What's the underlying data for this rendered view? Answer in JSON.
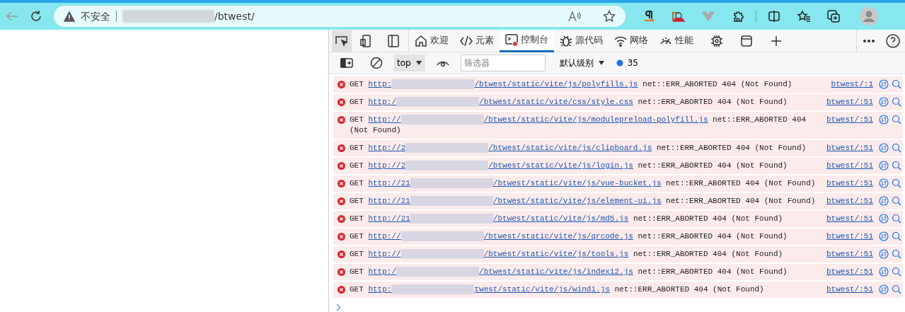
{
  "browser": {
    "address": {
      "security_label": "不安全",
      "url": "/btwest/"
    }
  },
  "devtools": {
    "tabs": [
      {
        "kind": "home",
        "label": "欢迎",
        "selected": false
      },
      {
        "kind": "code",
        "label": "元素",
        "selected": false
      },
      {
        "kind": "console",
        "label": "控制台",
        "selected": true
      },
      {
        "kind": "bug",
        "label": "源代码",
        "selected": false
      },
      {
        "kind": "wifi",
        "label": "网络",
        "selected": false
      },
      {
        "kind": "gauge",
        "label": "性能",
        "selected": false
      }
    ],
    "console_toolbar": {
      "context": "top",
      "filter_placeholder": "筛选器",
      "level_label": "默认级别",
      "issues_count": "35"
    },
    "messages": [
      {
        "method": "GET",
        "url_start": "http:",
        "url_end": "/btwest/static/vite/js/polyfills.js",
        "text": "net::ERR_ABORTED 404 (Not Found)",
        "source": "btwest/:1"
      },
      {
        "method": "GET",
        "url_start": "http:/",
        "url_end": "/btwest/static/vite/css/style.css",
        "text": "net::ERR_ABORTED 404 (Not Found)",
        "source": "btwest/:51"
      },
      {
        "method": "GET",
        "url_start": "http://",
        "url_end": "/btwest/static/vite/js/modulepreload-polyfill.js",
        "text": "net::ERR_ABORTED 404 (Not Found)",
        "source": "btwest/:51"
      },
      {
        "method": "GET",
        "url_start": "http://2",
        "url_end": "/btwest/static/vite/js/clipboard.js",
        "text": "net::ERR_ABORTED 404 (Not Found)",
        "source": "btwest/:51"
      },
      {
        "method": "GET",
        "url_start": "http://2",
        "url_end": "/btwest/static/vite/js/login.js",
        "text": "net::ERR_ABORTED 404 (Not Found)",
        "source": "btwest/:51"
      },
      {
        "method": "GET",
        "url_start": "http://21",
        "url_end": "/btwest/static/vite/js/vue-bucket.js",
        "text": "net::ERR_ABORTED 404 (Not Found)",
        "source": "btwest/:51"
      },
      {
        "method": "GET",
        "url_start": "http://21",
        "url_end": "/btwest/static/vite/js/element-ui.js",
        "text": "net::ERR_ABORTED 404 (Not Found)",
        "source": "btwest/:51"
      },
      {
        "method": "GET",
        "url_start": "http://21",
        "url_end": "/btwest/static/vite/js/md5.js",
        "text": "net::ERR_ABORTED 404 (Not Found)",
        "source": "btwest/:51"
      },
      {
        "method": "GET",
        "url_start": "http://",
        "url_end": "/btwest/static/vite/js/qrcode.js",
        "text": "net::ERR_ABORTED 404 (Not Found)",
        "source": "btwest/:51"
      },
      {
        "method": "GET",
        "url_start": "http://",
        "url_end": "/btwest/static/vite/js/tools.js",
        "text": "net::ERR_ABORTED 404 (Not Found)",
        "source": "btwest/:51"
      },
      {
        "method": "GET",
        "url_start": "http:/",
        "url_end": "/btwest/static/vite/js/index12.js",
        "text": "net::ERR_ABORTED 404 (Not Found)",
        "source": "btwest/:51"
      },
      {
        "method": "GET",
        "url_start": "http:",
        "url_end": "twest/static/vite/js/windi.js",
        "text": "net::ERR_ABORTED 404 (Not Found)",
        "source": "btwest/:51"
      }
    ]
  }
}
